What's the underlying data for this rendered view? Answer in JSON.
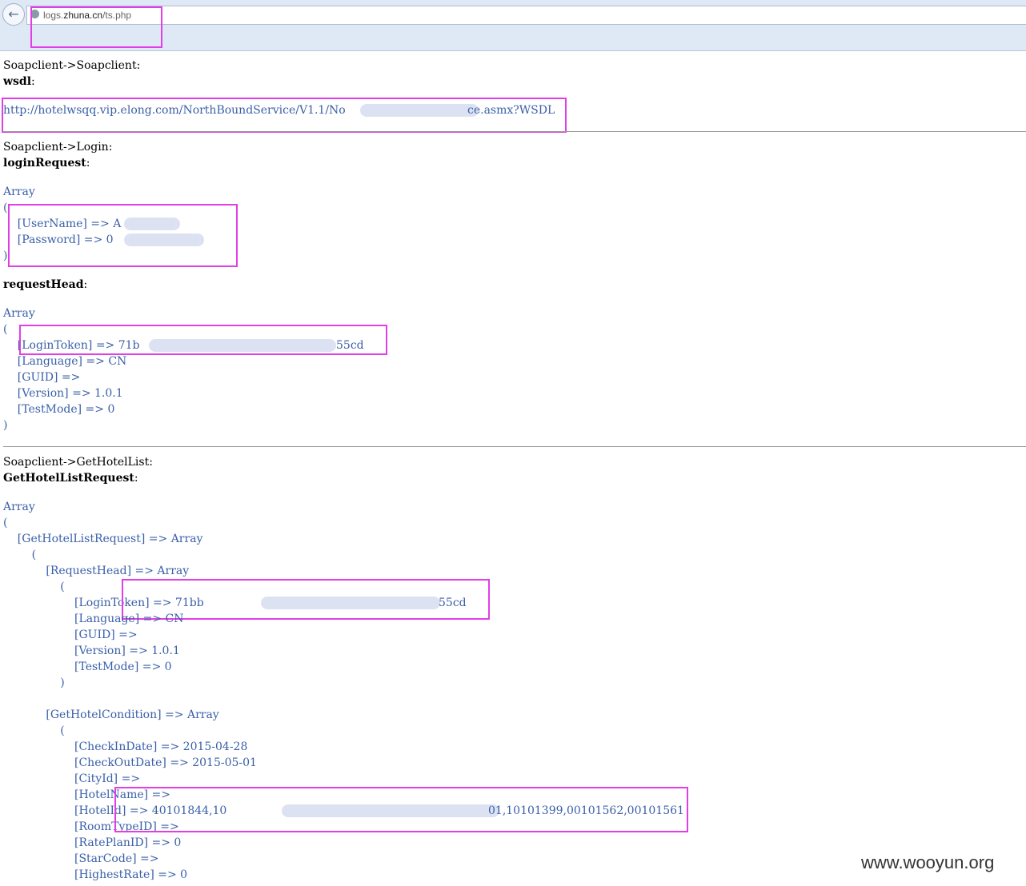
{
  "browser": {
    "back_icon": "back-arrow-icon",
    "url_prefix": "logs.",
    "url_domain": "zhuna.cn",
    "url_path": "/ts.php"
  },
  "wsdl": {
    "header": "Soapclient->Soapclient:",
    "label": "wsdl",
    "url": "http://hotelwsqq.vip.elong.com/NorthBoundService/V1.1/No",
    "url_tail": "ce.asmx?WSDL"
  },
  "login": {
    "header": "Soapclient->Login:",
    "request_label": "loginRequest",
    "array_kw": "Array",
    "open": "(",
    "close": ")",
    "username": "    [UserName] => A",
    "password": "    [Password] => 0",
    "head_label": "requestHead",
    "token": "    [LoginToken] => 71b",
    "token_tail": "55cd",
    "language": "    [Language] => CN",
    "guid": "    [GUID] =>",
    "version": "    [Version] => 1.0.1",
    "testmode": "    [TestMode] => 0"
  },
  "hotellist": {
    "header": "Soapclient->GetHotelList:",
    "request_label": "GetHotelListRequest",
    "array_kw": "Array",
    "open": "(",
    "req": "    [GetHotelListRequest] => Array",
    "open2": "        (",
    "reqhead": "            [RequestHead] => Array",
    "open3": "                (",
    "token": "                    [LoginToken] => 71bb",
    "token_tail": "55cd",
    "language": "                    [Language] => CN",
    "guid": "                    [GUID] =>",
    "version": "                    [Version] => 1.0.1",
    "testmode": "                    [TestMode] => 0",
    "close3": "                )",
    "cond": "            [GetHotelCondition] => Array",
    "open4": "                (",
    "checkin": "                    [CheckInDate] => 2015-04-28",
    "checkout": "                    [CheckOutDate] => 2015-05-01",
    "cityid": "                    [CityId] =>",
    "hotelname": "                    [HotelName] =>",
    "hotelid": "                    [HotelId] => 40101844,10",
    "hotelid_tail": "01,10101399,00101562,00101561",
    "roomtype": "                    [RoomTypeID] =>",
    "rateplan": "                    [RatePlanID] => 0",
    "starcode": "                    [StarCode] =>",
    "highestrate": "                    [HighestRate] => 0"
  },
  "watermark": "www.wooyun.org"
}
